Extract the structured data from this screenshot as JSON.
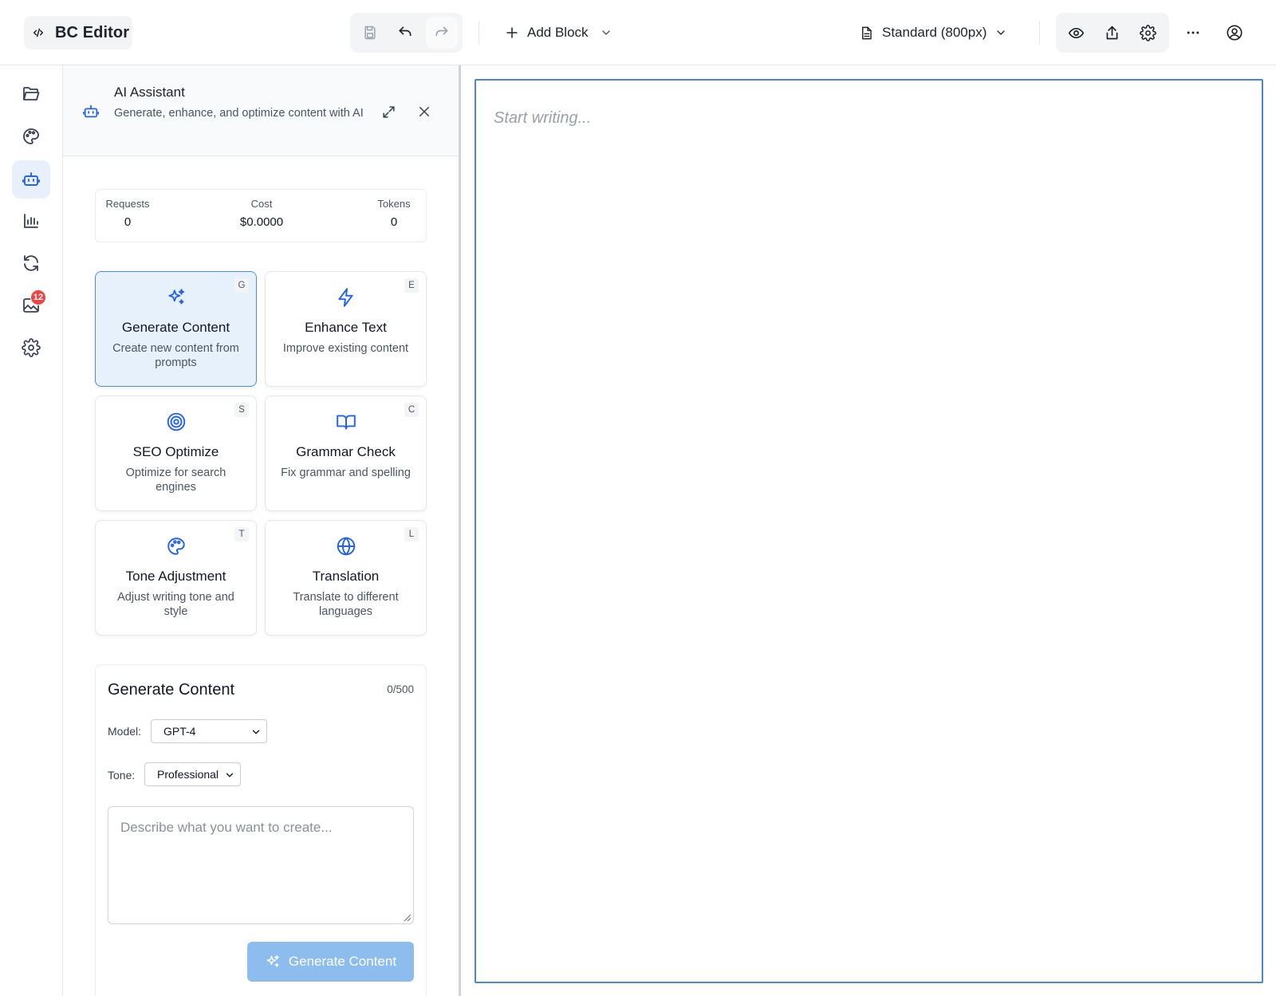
{
  "app": {
    "title": "BC Editor"
  },
  "toolbar": {
    "add_block_label": "Add Block",
    "page_size_label": "Standard (800px)"
  },
  "rail": {
    "items": [
      "folder",
      "palette",
      "ai-assistant",
      "analytics",
      "sync",
      "media",
      "settings"
    ],
    "media_badge": "12"
  },
  "ai_panel": {
    "title": "AI Assistant",
    "subtitle": "Generate, enhance, and optimize content with AI",
    "stats": {
      "requests_label": "Requests",
      "requests_value": "0",
      "cost_label": "Cost",
      "cost_value": "$0.0000",
      "tokens_label": "Tokens",
      "tokens_value": "0"
    },
    "tools": [
      {
        "key": "G",
        "title": "Generate Content",
        "desc": "Create new content from prompts",
        "icon": "sparkles-icon",
        "selected": true
      },
      {
        "key": "E",
        "title": "Enhance Text",
        "desc": "Improve existing content",
        "icon": "bolt-icon"
      },
      {
        "key": "S",
        "title": "SEO Optimize",
        "desc": "Optimize for search engines",
        "icon": "target-icon"
      },
      {
        "key": "C",
        "title": "Grammar Check",
        "desc": "Fix grammar and spelling",
        "icon": "book-icon"
      },
      {
        "key": "T",
        "title": "Tone Adjustment",
        "desc": "Adjust writing tone and style",
        "icon": "palette-icon"
      },
      {
        "key": "L",
        "title": "Translation",
        "desc": "Translate to different languages",
        "icon": "globe-icon"
      }
    ],
    "form": {
      "title": "Generate Content",
      "char_count": "0/500",
      "model_label": "Model:",
      "model_value": "GPT-4",
      "tone_label": "Tone:",
      "tone_value": "Professional",
      "prompt_placeholder": "Describe what you want to create...",
      "submit_label": "Generate Content"
    }
  },
  "editor": {
    "placeholder": "Start writing..."
  },
  "colors": {
    "accent": "#2563eb",
    "selected_card": "#e7f1fb",
    "editor_border": "#4a86d1",
    "badge": "#ef4444"
  }
}
